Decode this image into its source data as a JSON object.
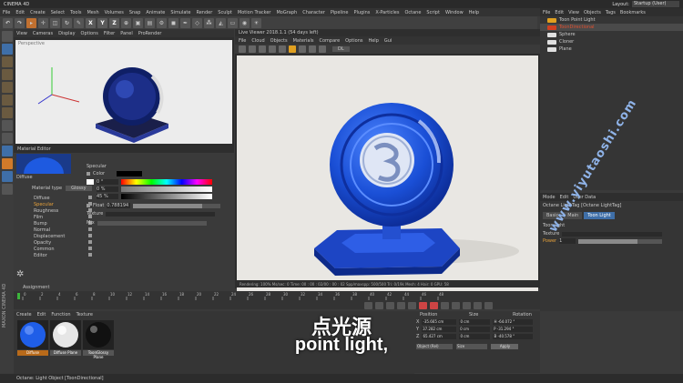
{
  "app": {
    "title": "CINEMA 4D",
    "layout_label": "Layout:",
    "layout_value": "Startup (User)"
  },
  "menu": [
    "File",
    "Edit",
    "Create",
    "Select",
    "Tools",
    "Mesh",
    "Volumes",
    "Snap",
    "Animate",
    "Simulate",
    "Render",
    "Sculpt",
    "Motion Tracker",
    "MoGraph",
    "Character",
    "Pipeline",
    "Plugins",
    "X-Particles",
    "Octane",
    "Script",
    "Window",
    "Help"
  ],
  "toolbar_axes": [
    "X",
    "Y",
    "Z"
  ],
  "viewport1": {
    "title": "Perspective",
    "menu": [
      "View",
      "Cameras",
      "Display",
      "Options",
      "Filter",
      "Panel",
      "ProRender"
    ]
  },
  "viewer": {
    "title": "Live Viewer 2018.1.1 (54 days left)",
    "menu": [
      "File",
      "Cloud",
      "Objects",
      "Materials",
      "Compare",
      "Options",
      "Help",
      "Gui"
    ],
    "mode": "DL",
    "status_text": "Rendering: 100%  Ms/sec: 0   Time: 00 : 00 : 02/00 : 00 : 02   Spp/maxspp: 500/500   Tri: 0/19k   Mesh: 4   Hair: 0   GPU: 58",
    "bottom_tabs": [
      "Main",
      "Note"
    ]
  },
  "material_editor": {
    "title": "Material Editor",
    "material_name": "Diffuse",
    "type_label": "Material type",
    "type_value": "Glossy",
    "list": [
      "Diffuse",
      "Specular",
      "Roughness",
      "Film",
      "Bump",
      "Normal",
      "Displacement",
      "Opacity",
      "Common",
      "Editor"
    ],
    "assign_label": "Assignment",
    "specular_label": "Specular",
    "color_label": "Color",
    "mix_label": "Mix",
    "float_label": "Float",
    "float_value": "0.788194",
    "texture_label": "Texture",
    "h_value": "0 °",
    "s_value": "0 %",
    "v_value": "45 %"
  },
  "object_manager": {
    "menu": [
      "File",
      "Edit",
      "View",
      "Objects",
      "Tags",
      "Bookmarks"
    ],
    "objects": [
      {
        "name": "Toon Point Light",
        "color": "#e0a020"
      },
      {
        "name": "ToonDirectional",
        "color": "#d04020"
      },
      {
        "name": "Sphere",
        "color": "#e0e0e0"
      },
      {
        "name": "Cloner",
        "color": "#e0e0e0"
      },
      {
        "name": "Plane",
        "color": "#e0e0e0"
      }
    ]
  },
  "attributes": {
    "menu": [
      "Mode",
      "Edit",
      "User Data"
    ],
    "title": "Octane LightTag [Octane LightTag]",
    "tabs": [
      "Basic",
      "Main",
      "Toon Light"
    ],
    "section": "Toon light",
    "texture_label": "Texture",
    "power_label": "Power",
    "power_value": "1"
  },
  "timeline": {
    "ticks": [
      "0",
      "2",
      "4",
      "6",
      "8",
      "10",
      "12",
      "14",
      "16",
      "18",
      "20",
      "22",
      "24",
      "26",
      "28",
      "30",
      "32",
      "34",
      "36",
      "38",
      "40",
      "42",
      "44",
      "46",
      "48"
    ]
  },
  "material_manager": {
    "menu": [
      "Create",
      "Edit",
      "Function",
      "Texture"
    ],
    "materials": [
      "Diffuse",
      "Diffuse Plane",
      "ToonGlossy Plane"
    ]
  },
  "coordinates": {
    "headers": [
      "Position",
      "Size",
      "Rotation"
    ],
    "rows": [
      {
        "axis": "X",
        "pos": "-35.665 cm",
        "size": "0 cm",
        "rot": "H  -64.072 °"
      },
      {
        "axis": "Y",
        "pos": "37.282 cm",
        "size": "0 cm",
        "rot": "P  -31.294 °"
      },
      {
        "axis": "Z",
        "pos": "65.427 cm",
        "size": "0 cm",
        "rot": "B  -40.578 °"
      }
    ],
    "mode1": "Object (Rel)",
    "mode2": "Size",
    "apply": "Apply"
  },
  "status": {
    "text": "Octane:    Light Object [ToonDirectional]"
  },
  "subtitle": {
    "zh": "点光源",
    "en": "point light,"
  },
  "watermark": "www.yiyutaoshi.com",
  "maxon_label": "MAXON CINEMA 4D"
}
